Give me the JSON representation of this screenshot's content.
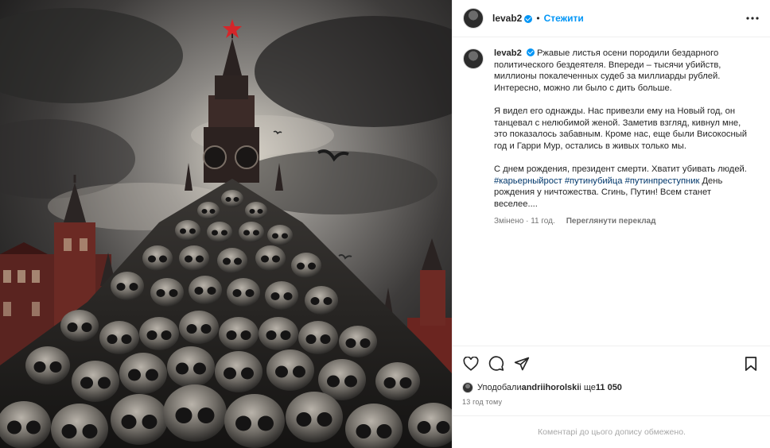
{
  "post": {
    "username": "levab2",
    "follow_label": "Стежити",
    "dot": "•",
    "caption": {
      "paragraph1": "Ржавые листья осени породили бездарного политического бездеятеля. Впереди – тысячи убийств, миллионы покалеченных судеб за миллиарды рублей. Интересно, можно ли было с      дить больше.",
      "paragraph2": "Я видел его однажды. Нас привезли ему на Новый год, он танцевал с нелюбимой женой. Заметив взгляд, кивнул мне, это показалось забавным. Кроме нас, еще были Високосный год и Гарри Мур, остались в живых только мы.",
      "paragraph3_text": "С днем рождения, президент смерти. Хватит убивать людей.",
      "hashtags": "#карьерныйрост #путинубийца #путинпреступник",
      "paragraph3_tail": "День рождения у ничтожества. Сгинь, Путин! Всем станет веселее....",
      "edited": "Змінено · 11 год.",
      "translate": "Переглянути переклад"
    },
    "likes": {
      "prefix": "Уподобали ",
      "user": "andriihorolski",
      "suffix": " і ще ",
      "count": "11 050"
    },
    "time_ago": "13 год тому",
    "comments_limited": "Коментарі до цього допису обмежено."
  },
  "icons": {
    "verified": "verified-badge-icon",
    "more": "more-options-icon",
    "like": "heart-icon",
    "comment": "comment-icon",
    "share": "share-icon",
    "save": "bookmark-icon"
  },
  "colors": {
    "accent": "#0095f6",
    "hashtag": "#00376b",
    "muted": "#737373",
    "star": "#d4262a"
  }
}
